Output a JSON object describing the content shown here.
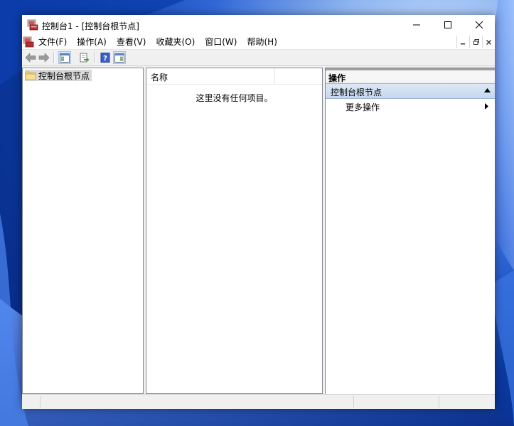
{
  "window": {
    "title": "控制台1 - [控制台根节点]"
  },
  "menubar": {
    "items": [
      {
        "label": "文件(F)"
      },
      {
        "label": "操作(A)"
      },
      {
        "label": "查看(V)"
      },
      {
        "label": "收藏夹(O)"
      },
      {
        "label": "窗口(W)"
      },
      {
        "label": "帮助(H)"
      }
    ]
  },
  "toolbar": {
    "icons": [
      "back-arrow-icon",
      "forward-arrow-icon",
      "show-hide-tree-icon",
      "export-list-icon",
      "help-icon",
      "show-hide-action-pane-icon"
    ]
  },
  "tree": {
    "root_label": "控制台根节点"
  },
  "list": {
    "column_name": "名称",
    "empty_message": "这里没有任何项目。"
  },
  "actions": {
    "header": "操作",
    "group_label": "控制台根节点",
    "more_actions": "更多操作"
  },
  "colors": {
    "accent": "#c6d7ee",
    "pane_border": "#828790",
    "selected_node": "#d9d9d9"
  }
}
